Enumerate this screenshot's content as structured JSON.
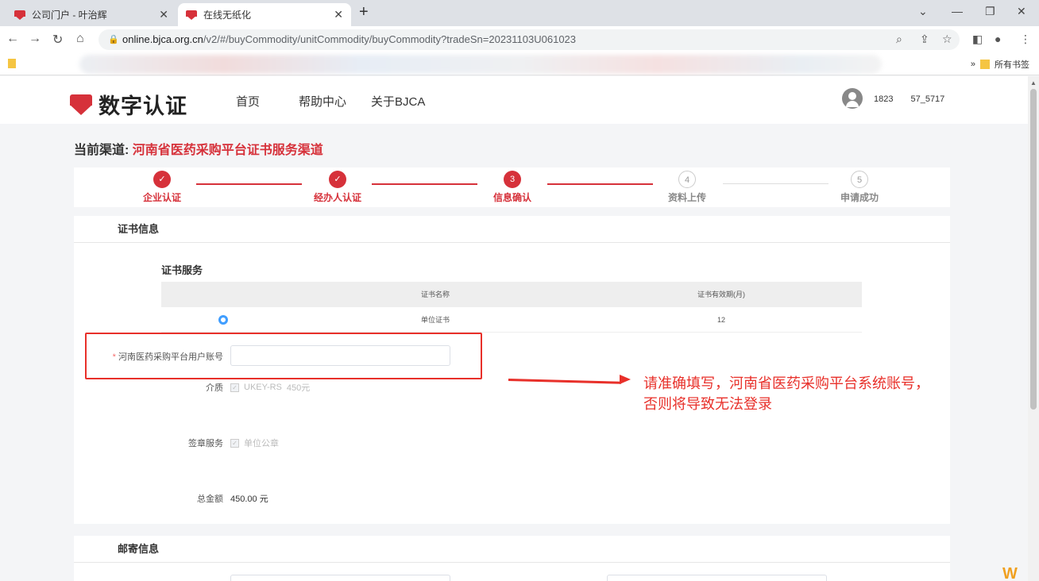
{
  "browser": {
    "tabs": [
      {
        "title": "公司门户 - 叶治辉",
        "active": false
      },
      {
        "title": "在线无纸化",
        "active": true
      }
    ],
    "url_host": "online.bjca.org.cn",
    "url_path": "/v2/#/buyCommodity/unitCommodity/buyCommodity?tradeSn=20231103U061023",
    "bookmarks_label": "所有书签"
  },
  "header": {
    "brand": "数字认证",
    "menu": [
      "首页",
      "帮助中心",
      "关于BJCA"
    ],
    "user": "1823　　57_5717"
  },
  "channel": {
    "label": "当前渠道:",
    "name": "河南省医药采购平台证书服务渠道"
  },
  "steps": [
    {
      "num": "✓",
      "label": "企业认证",
      "state": "done"
    },
    {
      "num": "✓",
      "label": "经办人认证",
      "state": "done"
    },
    {
      "num": "3",
      "label": "信息确认",
      "state": "current"
    },
    {
      "num": "4",
      "label": "资料上传",
      "state": "todo"
    },
    {
      "num": "5",
      "label": "申请成功",
      "state": "todo"
    }
  ],
  "cert_info": {
    "title": "证书信息",
    "service_title": "证书服务",
    "table": {
      "headers": [
        "证书名称",
        "证书有效期(月)"
      ],
      "rows": [
        {
          "name": "单位证书",
          "validity": "12"
        }
      ]
    },
    "account_label": "河南医药采购平台用户账号",
    "account_value": "",
    "medium_label": "介质",
    "medium_value": "UKEY-RS",
    "medium_price": "450元",
    "seal_label": "签章服务",
    "seal_value": "单位公章",
    "total_label": "总金额",
    "total_value": "450.00 元"
  },
  "annotation": {
    "line1": "请准确填写，河南省医药采购平台系统账号，",
    "line2": "否则将导致无法登录"
  },
  "mail_info": {
    "title": "邮寄信息"
  },
  "colors": {
    "brand_red": "#d6313a",
    "annotation_red": "#e8302a",
    "radio_blue": "#409eff"
  }
}
